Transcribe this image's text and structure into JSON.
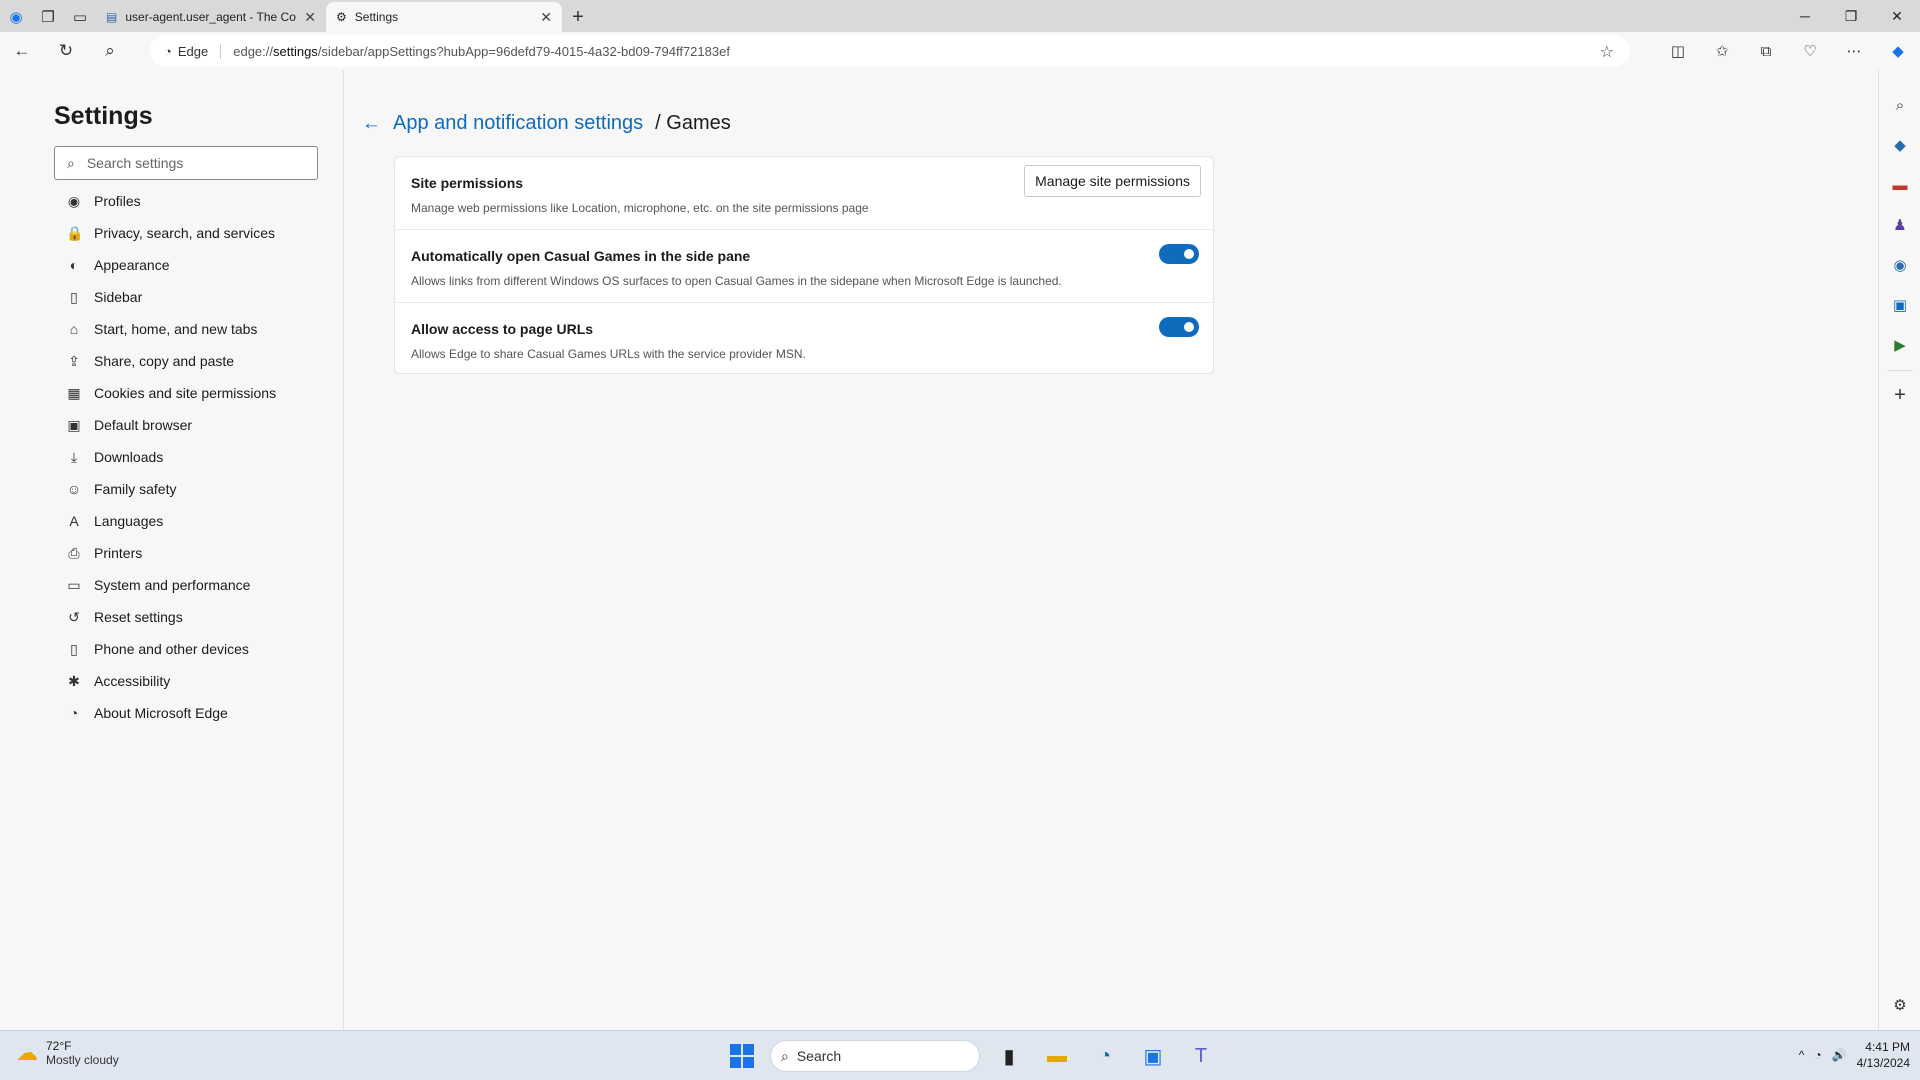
{
  "browser": {
    "tabs": [
      {
        "title": "user-agent.user_agent - The Coll",
        "active": false
      },
      {
        "title": "Settings",
        "active": true
      }
    ],
    "address": {
      "site_label": "Edge",
      "url_prefix": "edge://",
      "url_bold": "settings",
      "url_rest": "/sidebar/appSettings?hubApp=96defd79-4015-4a32-bd09-794ff72183ef"
    }
  },
  "settings": {
    "title": "Settings",
    "search_placeholder": "Search settings",
    "nav": [
      {
        "label": "Profiles",
        "icon": "profile-icon",
        "glyph": "◉"
      },
      {
        "label": "Privacy, search, and services",
        "icon": "lock-icon",
        "glyph": "🔒"
      },
      {
        "label": "Appearance",
        "icon": "palette-icon",
        "glyph": "◐"
      },
      {
        "label": "Sidebar",
        "icon": "sidebar-icon",
        "glyph": "▯"
      },
      {
        "label": "Start, home, and new tabs",
        "icon": "home-icon",
        "glyph": "⌂"
      },
      {
        "label": "Share, copy and paste",
        "icon": "share-icon",
        "glyph": "⇪"
      },
      {
        "label": "Cookies and site permissions",
        "icon": "cookie-icon",
        "glyph": "▦"
      },
      {
        "label": "Default browser",
        "icon": "browser-icon",
        "glyph": "▣"
      },
      {
        "label": "Downloads",
        "icon": "download-icon",
        "glyph": "⤓"
      },
      {
        "label": "Family safety",
        "icon": "family-icon",
        "glyph": "☺"
      },
      {
        "label": "Languages",
        "icon": "language-icon",
        "glyph": "A"
      },
      {
        "label": "Printers",
        "icon": "printer-icon",
        "glyph": "⎙"
      },
      {
        "label": "System and performance",
        "icon": "system-icon",
        "glyph": "▭"
      },
      {
        "label": "Reset settings",
        "icon": "reset-icon",
        "glyph": "↺"
      },
      {
        "label": "Phone and other devices",
        "icon": "phone-icon",
        "glyph": "▯"
      },
      {
        "label": "Accessibility",
        "icon": "accessibility-icon",
        "glyph": "✱"
      },
      {
        "label": "About Microsoft Edge",
        "icon": "edge-icon",
        "glyph": "◔"
      }
    ]
  },
  "page": {
    "breadcrumb_parent": "App and notification settings",
    "breadcrumb_separator": "/",
    "breadcrumb_current": "Games",
    "rows": [
      {
        "title": "Site permissions",
        "description": "Manage web permissions like Location, microphone, etc. on the site permissions page",
        "button": "Manage site permissions"
      },
      {
        "title": "Automatically open Casual Games in the side pane",
        "description": "Allows links from different Windows OS surfaces to open Casual Games in the sidepane when Microsoft Edge is launched.",
        "toggle_on": true
      },
      {
        "title": "Allow access to page URLs",
        "description": "Allows Edge to share Casual Games URLs with the service provider MSN.",
        "toggle_on": true
      }
    ]
  },
  "taskbar": {
    "weather_temp": "72°F",
    "weather_condition": "Mostly cloudy",
    "search_label": "Search",
    "time": "4:41 PM",
    "date": "4/13/2024"
  },
  "colors": {
    "accent": "#0f6cbd",
    "toggle_on": "#0f6cbd"
  }
}
